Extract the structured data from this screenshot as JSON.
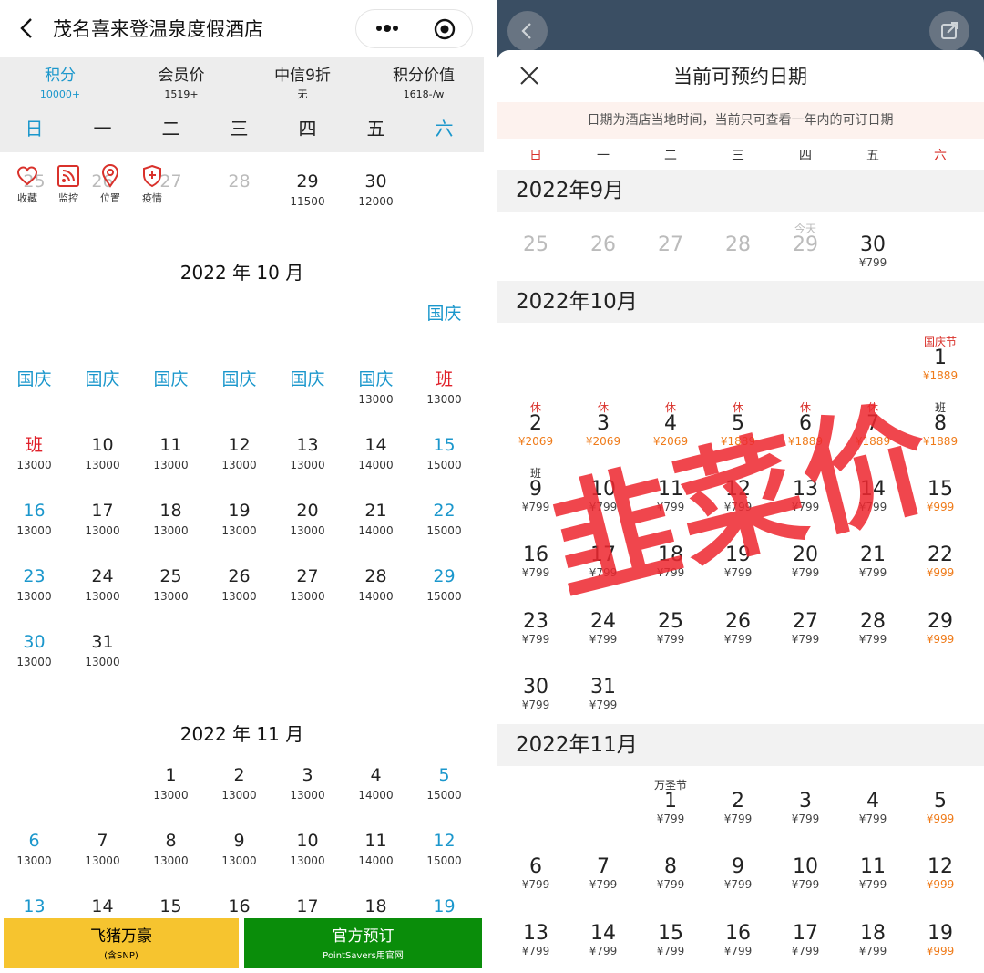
{
  "left": {
    "title": "茂名喜来登温泉度假酒店",
    "metrics": [
      {
        "label": "积分",
        "value": "10000+",
        "active": true
      },
      {
        "label": "会员价",
        "value": "1519+"
      },
      {
        "label": "中信9折",
        "value": "无"
      },
      {
        "label": "积分价值",
        "value": "1618-/w"
      }
    ],
    "weekdays": [
      "日",
      "一",
      "二",
      "三",
      "四",
      "五",
      "六"
    ],
    "actions": [
      {
        "label": "收藏",
        "icon": "heart-icon"
      },
      {
        "label": "监控",
        "icon": "rss-icon"
      },
      {
        "label": "位置",
        "icon": "location-icon"
      },
      {
        "label": "疫情",
        "icon": "shield-plus-icon"
      }
    ],
    "sep_row": {
      "cells": [
        {
          "col": 0,
          "n": "25",
          "gray": true
        },
        {
          "col": 1,
          "n": "26",
          "gray": true
        },
        {
          "col": 2,
          "n": "27",
          "gray": true
        },
        {
          "col": 3,
          "n": "28",
          "gray": true
        },
        {
          "col": 4,
          "n": "29",
          "s": "11500"
        },
        {
          "col": 5,
          "n": "30",
          "s": "12000"
        }
      ]
    },
    "oct_title": "2022 年 10 月",
    "oct_rows": [
      [
        {
          "col": 6,
          "n": "国庆",
          "c": "blue"
        }
      ],
      [
        {
          "col": 0,
          "n": "国庆",
          "c": "blue"
        },
        {
          "col": 1,
          "n": "国庆",
          "c": "blue"
        },
        {
          "col": 2,
          "n": "国庆",
          "c": "blue"
        },
        {
          "col": 3,
          "n": "国庆",
          "c": "blue"
        },
        {
          "col": 4,
          "n": "国庆",
          "c": "blue"
        },
        {
          "col": 5,
          "n": "国庆",
          "c": "blue",
          "s": "13000"
        },
        {
          "col": 6,
          "n": "班",
          "c": "red",
          "s": "13000"
        }
      ],
      [
        {
          "col": 0,
          "n": "班",
          "c": "red",
          "s": "13000"
        },
        {
          "col": 1,
          "n": "10",
          "s": "13000"
        },
        {
          "col": 2,
          "n": "11",
          "s": "13000"
        },
        {
          "col": 3,
          "n": "12",
          "s": "13000"
        },
        {
          "col": 4,
          "n": "13",
          "s": "13000"
        },
        {
          "col": 5,
          "n": "14",
          "s": "14000"
        },
        {
          "col": 6,
          "n": "15",
          "c": "blue",
          "s": "15000"
        }
      ],
      [
        {
          "col": 0,
          "n": "16",
          "c": "blue",
          "s": "13000"
        },
        {
          "col": 1,
          "n": "17",
          "s": "13000"
        },
        {
          "col": 2,
          "n": "18",
          "s": "13000"
        },
        {
          "col": 3,
          "n": "19",
          "s": "13000"
        },
        {
          "col": 4,
          "n": "20",
          "s": "13000"
        },
        {
          "col": 5,
          "n": "21",
          "s": "14000"
        },
        {
          "col": 6,
          "n": "22",
          "c": "blue",
          "s": "15000"
        }
      ],
      [
        {
          "col": 0,
          "n": "23",
          "c": "blue",
          "s": "13000"
        },
        {
          "col": 1,
          "n": "24",
          "s": "13000"
        },
        {
          "col": 2,
          "n": "25",
          "s": "13000"
        },
        {
          "col": 3,
          "n": "26",
          "s": "13000"
        },
        {
          "col": 4,
          "n": "27",
          "s": "13000"
        },
        {
          "col": 5,
          "n": "28",
          "s": "14000"
        },
        {
          "col": 6,
          "n": "29",
          "c": "blue",
          "s": "15000"
        }
      ],
      [
        {
          "col": 0,
          "n": "30",
          "c": "blue",
          "s": "13000"
        },
        {
          "col": 1,
          "n": "31",
          "s": "13000"
        }
      ]
    ],
    "nov_title": "2022 年 11 月",
    "nov_rows": [
      [
        {
          "col": 2,
          "n": "1",
          "s": "13000"
        },
        {
          "col": 3,
          "n": "2",
          "s": "13000"
        },
        {
          "col": 4,
          "n": "3",
          "s": "13000"
        },
        {
          "col": 5,
          "n": "4",
          "s": "14000"
        },
        {
          "col": 6,
          "n": "5",
          "c": "blue",
          "s": "15000"
        }
      ],
      [
        {
          "col": 0,
          "n": "6",
          "c": "blue",
          "s": "13000"
        },
        {
          "col": 1,
          "n": "7",
          "s": "13000"
        },
        {
          "col": 2,
          "n": "8",
          "s": "13000"
        },
        {
          "col": 3,
          "n": "9",
          "s": "13000"
        },
        {
          "col": 4,
          "n": "10",
          "s": "13000"
        },
        {
          "col": 5,
          "n": "11",
          "s": "14000"
        },
        {
          "col": 6,
          "n": "12",
          "c": "blue",
          "s": "15000"
        }
      ],
      [
        {
          "col": 0,
          "n": "13",
          "c": "blue"
        },
        {
          "col": 1,
          "n": "14"
        },
        {
          "col": 2,
          "n": "15"
        },
        {
          "col": 3,
          "n": "16"
        },
        {
          "col": 4,
          "n": "17"
        },
        {
          "col": 5,
          "n": "18"
        },
        {
          "col": 6,
          "n": "19",
          "c": "blue"
        }
      ]
    ],
    "buttons": [
      {
        "main": "飞猪万豪",
        "sub": "(含SNP)"
      },
      {
        "main": "官方预订",
        "sub": "PointSavers用官网"
      }
    ]
  },
  "right": {
    "title": "当前可预约日期",
    "notice": "日期为酒店当地时间，当前只可查看一年内的可订日期",
    "weekdays": [
      "日",
      "一",
      "二",
      "三",
      "四",
      "五",
      "六"
    ],
    "months": [
      "2022年9月",
      "2022年10月",
      "2022年11月"
    ],
    "sep_rows": [
      [
        {
          "col": 0,
          "n": "25",
          "gray": true
        },
        {
          "col": 1,
          "n": "26",
          "gray": true
        },
        {
          "col": 2,
          "n": "27",
          "gray": true
        },
        {
          "col": 3,
          "n": "28",
          "gray": true
        },
        {
          "col": 4,
          "n": "29",
          "gray": true,
          "t": "今天",
          "tc": "gray"
        },
        {
          "col": 5,
          "n": "30",
          "s": "¥799"
        }
      ]
    ],
    "oct_rows": [
      [
        {
          "col": 6,
          "n": "1",
          "t": "国庆节",
          "tc": "red",
          "s": "¥1889",
          "sc": "org"
        }
      ],
      [
        {
          "col": 0,
          "n": "2",
          "t": "休",
          "tc": "red",
          "s": "¥2069",
          "sc": "org"
        },
        {
          "col": 1,
          "n": "3",
          "t": "休",
          "tc": "red",
          "s": "¥2069",
          "sc": "org"
        },
        {
          "col": 2,
          "n": "4",
          "t": "休",
          "tc": "red",
          "s": "¥2069",
          "sc": "org"
        },
        {
          "col": 3,
          "n": "5",
          "t": "休",
          "tc": "red",
          "s": "¥1889",
          "sc": "org"
        },
        {
          "col": 4,
          "n": "6",
          "t": "休",
          "tc": "red",
          "s": "¥1889",
          "sc": "org"
        },
        {
          "col": 5,
          "n": "7",
          "t": "休",
          "tc": "red",
          "s": "¥1889",
          "sc": "org"
        },
        {
          "col": 6,
          "n": "8",
          "t": "班",
          "tc": "dark",
          "s": "¥1889",
          "sc": "org"
        }
      ],
      [
        {
          "col": 0,
          "n": "9",
          "t": "班",
          "tc": "dark",
          "s": "¥799"
        },
        {
          "col": 1,
          "n": "10",
          "s": "¥799"
        },
        {
          "col": 2,
          "n": "11",
          "s": "¥799"
        },
        {
          "col": 3,
          "n": "12",
          "s": "¥799"
        },
        {
          "col": 4,
          "n": "13",
          "s": "¥799"
        },
        {
          "col": 5,
          "n": "14",
          "s": "¥799"
        },
        {
          "col": 6,
          "n": "15",
          "s": "¥999",
          "sc": "org"
        }
      ],
      [
        {
          "col": 0,
          "n": "16",
          "s": "¥799"
        },
        {
          "col": 1,
          "n": "17",
          "s": "¥799"
        },
        {
          "col": 2,
          "n": "18",
          "s": "¥799"
        },
        {
          "col": 3,
          "n": "19",
          "s": "¥799"
        },
        {
          "col": 4,
          "n": "20",
          "s": "¥799"
        },
        {
          "col": 5,
          "n": "21",
          "s": "¥799"
        },
        {
          "col": 6,
          "n": "22",
          "s": "¥999",
          "sc": "org"
        }
      ],
      [
        {
          "col": 0,
          "n": "23",
          "s": "¥799"
        },
        {
          "col": 1,
          "n": "24",
          "s": "¥799"
        },
        {
          "col": 2,
          "n": "25",
          "s": "¥799"
        },
        {
          "col": 3,
          "n": "26",
          "s": "¥799"
        },
        {
          "col": 4,
          "n": "27",
          "s": "¥799"
        },
        {
          "col": 5,
          "n": "28",
          "s": "¥799"
        },
        {
          "col": 6,
          "n": "29",
          "s": "¥999",
          "sc": "org"
        }
      ],
      [
        {
          "col": 0,
          "n": "30",
          "s": "¥799"
        },
        {
          "col": 1,
          "n": "31",
          "s": "¥799"
        }
      ]
    ],
    "nov_rows": [
      [
        {
          "col": 2,
          "n": "1",
          "t": "万圣节",
          "tc": "dark",
          "s": "¥799"
        },
        {
          "col": 3,
          "n": "2",
          "s": "¥799"
        },
        {
          "col": 4,
          "n": "3",
          "s": "¥799"
        },
        {
          "col": 5,
          "n": "4",
          "s": "¥799"
        },
        {
          "col": 6,
          "n": "5",
          "s": "¥999",
          "sc": "org"
        }
      ],
      [
        {
          "col": 0,
          "n": "6",
          "s": "¥799"
        },
        {
          "col": 1,
          "n": "7",
          "s": "¥799"
        },
        {
          "col": 2,
          "n": "8",
          "s": "¥799"
        },
        {
          "col": 3,
          "n": "9",
          "s": "¥799"
        },
        {
          "col": 4,
          "n": "10",
          "s": "¥799"
        },
        {
          "col": 5,
          "n": "11",
          "s": "¥799"
        },
        {
          "col": 6,
          "n": "12",
          "s": "¥999",
          "sc": "org"
        }
      ],
      [
        {
          "col": 0,
          "n": "13",
          "s": "¥799"
        },
        {
          "col": 1,
          "n": "14",
          "s": "¥799"
        },
        {
          "col": 2,
          "n": "15",
          "s": "¥799"
        },
        {
          "col": 3,
          "n": "16",
          "s": "¥799"
        },
        {
          "col": 4,
          "n": "17",
          "s": "¥799"
        },
        {
          "col": 5,
          "n": "18",
          "s": "¥799"
        },
        {
          "col": 6,
          "n": "19",
          "s": "¥999",
          "sc": "org"
        }
      ]
    ],
    "stamp": "韭菜价"
  },
  "colors": {
    "blue": "#1b97cc",
    "red": "#e0202a",
    "orange": "#ef7b1a",
    "green": "#0a8d0a",
    "yellow": "#f6c42f",
    "stamp": "#ee2830"
  }
}
